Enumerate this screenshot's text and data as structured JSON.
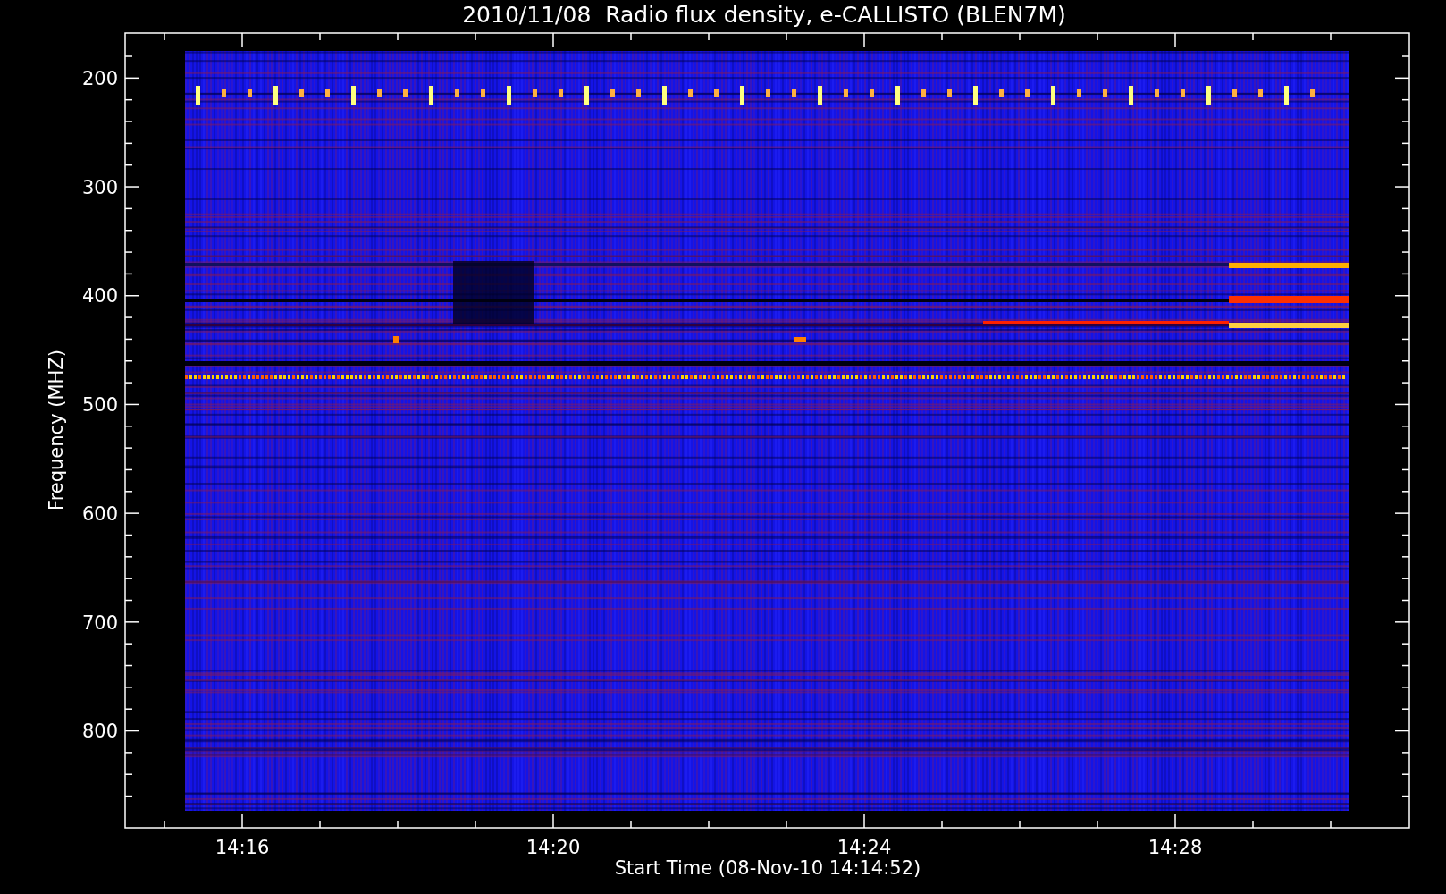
{
  "title": "2010/11/08  Radio flux density, e-CALLISTO (BLEN7M)",
  "y_axis": {
    "label": "Frequency (MHZ)",
    "ticks": [
      "200",
      "300",
      "400",
      "500",
      "600",
      "700",
      "800"
    ]
  },
  "x_axis": {
    "label": "Start Time (08-Nov-10 14:14:52)",
    "ticks": [
      "14:16",
      "14:20",
      "14:24",
      "14:28"
    ]
  }
}
